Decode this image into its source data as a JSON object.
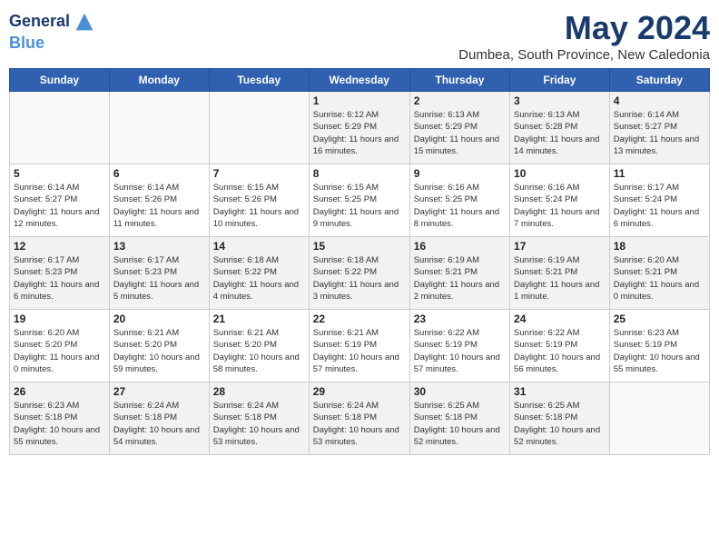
{
  "logo": {
    "line1": "General",
    "line2": "Blue"
  },
  "title": "May 2024",
  "location": "Dumbea, South Province, New Caledonia",
  "days_of_week": [
    "Sunday",
    "Monday",
    "Tuesday",
    "Wednesday",
    "Thursday",
    "Friday",
    "Saturday"
  ],
  "weeks": [
    [
      {
        "date": "",
        "content": ""
      },
      {
        "date": "",
        "content": ""
      },
      {
        "date": "",
        "content": ""
      },
      {
        "date": "1",
        "content": "Sunrise: 6:12 AM\nSunset: 5:29 PM\nDaylight: 11 hours and 16 minutes."
      },
      {
        "date": "2",
        "content": "Sunrise: 6:13 AM\nSunset: 5:29 PM\nDaylight: 11 hours and 15 minutes."
      },
      {
        "date": "3",
        "content": "Sunrise: 6:13 AM\nSunset: 5:28 PM\nDaylight: 11 hours and 14 minutes."
      },
      {
        "date": "4",
        "content": "Sunrise: 6:14 AM\nSunset: 5:27 PM\nDaylight: 11 hours and 13 minutes."
      }
    ],
    [
      {
        "date": "5",
        "content": "Sunrise: 6:14 AM\nSunset: 5:27 PM\nDaylight: 11 hours and 12 minutes."
      },
      {
        "date": "6",
        "content": "Sunrise: 6:14 AM\nSunset: 5:26 PM\nDaylight: 11 hours and 11 minutes."
      },
      {
        "date": "7",
        "content": "Sunrise: 6:15 AM\nSunset: 5:26 PM\nDaylight: 11 hours and 10 minutes."
      },
      {
        "date": "8",
        "content": "Sunrise: 6:15 AM\nSunset: 5:25 PM\nDaylight: 11 hours and 9 minutes."
      },
      {
        "date": "9",
        "content": "Sunrise: 6:16 AM\nSunset: 5:25 PM\nDaylight: 11 hours and 8 minutes."
      },
      {
        "date": "10",
        "content": "Sunrise: 6:16 AM\nSunset: 5:24 PM\nDaylight: 11 hours and 7 minutes."
      },
      {
        "date": "11",
        "content": "Sunrise: 6:17 AM\nSunset: 5:24 PM\nDaylight: 11 hours and 6 minutes."
      }
    ],
    [
      {
        "date": "12",
        "content": "Sunrise: 6:17 AM\nSunset: 5:23 PM\nDaylight: 11 hours and 6 minutes."
      },
      {
        "date": "13",
        "content": "Sunrise: 6:17 AM\nSunset: 5:23 PM\nDaylight: 11 hours and 5 minutes."
      },
      {
        "date": "14",
        "content": "Sunrise: 6:18 AM\nSunset: 5:22 PM\nDaylight: 11 hours and 4 minutes."
      },
      {
        "date": "15",
        "content": "Sunrise: 6:18 AM\nSunset: 5:22 PM\nDaylight: 11 hours and 3 minutes."
      },
      {
        "date": "16",
        "content": "Sunrise: 6:19 AM\nSunset: 5:21 PM\nDaylight: 11 hours and 2 minutes."
      },
      {
        "date": "17",
        "content": "Sunrise: 6:19 AM\nSunset: 5:21 PM\nDaylight: 11 hours and 1 minute."
      },
      {
        "date": "18",
        "content": "Sunrise: 6:20 AM\nSunset: 5:21 PM\nDaylight: 11 hours and 0 minutes."
      }
    ],
    [
      {
        "date": "19",
        "content": "Sunrise: 6:20 AM\nSunset: 5:20 PM\nDaylight: 11 hours and 0 minutes."
      },
      {
        "date": "20",
        "content": "Sunrise: 6:21 AM\nSunset: 5:20 PM\nDaylight: 10 hours and 59 minutes."
      },
      {
        "date": "21",
        "content": "Sunrise: 6:21 AM\nSunset: 5:20 PM\nDaylight: 10 hours and 58 minutes."
      },
      {
        "date": "22",
        "content": "Sunrise: 6:21 AM\nSunset: 5:19 PM\nDaylight: 10 hours and 57 minutes."
      },
      {
        "date": "23",
        "content": "Sunrise: 6:22 AM\nSunset: 5:19 PM\nDaylight: 10 hours and 57 minutes."
      },
      {
        "date": "24",
        "content": "Sunrise: 6:22 AM\nSunset: 5:19 PM\nDaylight: 10 hours and 56 minutes."
      },
      {
        "date": "25",
        "content": "Sunrise: 6:23 AM\nSunset: 5:19 PM\nDaylight: 10 hours and 55 minutes."
      }
    ],
    [
      {
        "date": "26",
        "content": "Sunrise: 6:23 AM\nSunset: 5:18 PM\nDaylight: 10 hours and 55 minutes."
      },
      {
        "date": "27",
        "content": "Sunrise: 6:24 AM\nSunset: 5:18 PM\nDaylight: 10 hours and 54 minutes."
      },
      {
        "date": "28",
        "content": "Sunrise: 6:24 AM\nSunset: 5:18 PM\nDaylight: 10 hours and 53 minutes."
      },
      {
        "date": "29",
        "content": "Sunrise: 6:24 AM\nSunset: 5:18 PM\nDaylight: 10 hours and 53 minutes."
      },
      {
        "date": "30",
        "content": "Sunrise: 6:25 AM\nSunset: 5:18 PM\nDaylight: 10 hours and 52 minutes."
      },
      {
        "date": "31",
        "content": "Sunrise: 6:25 AM\nSunset: 5:18 PM\nDaylight: 10 hours and 52 minutes."
      },
      {
        "date": "",
        "content": ""
      }
    ]
  ]
}
